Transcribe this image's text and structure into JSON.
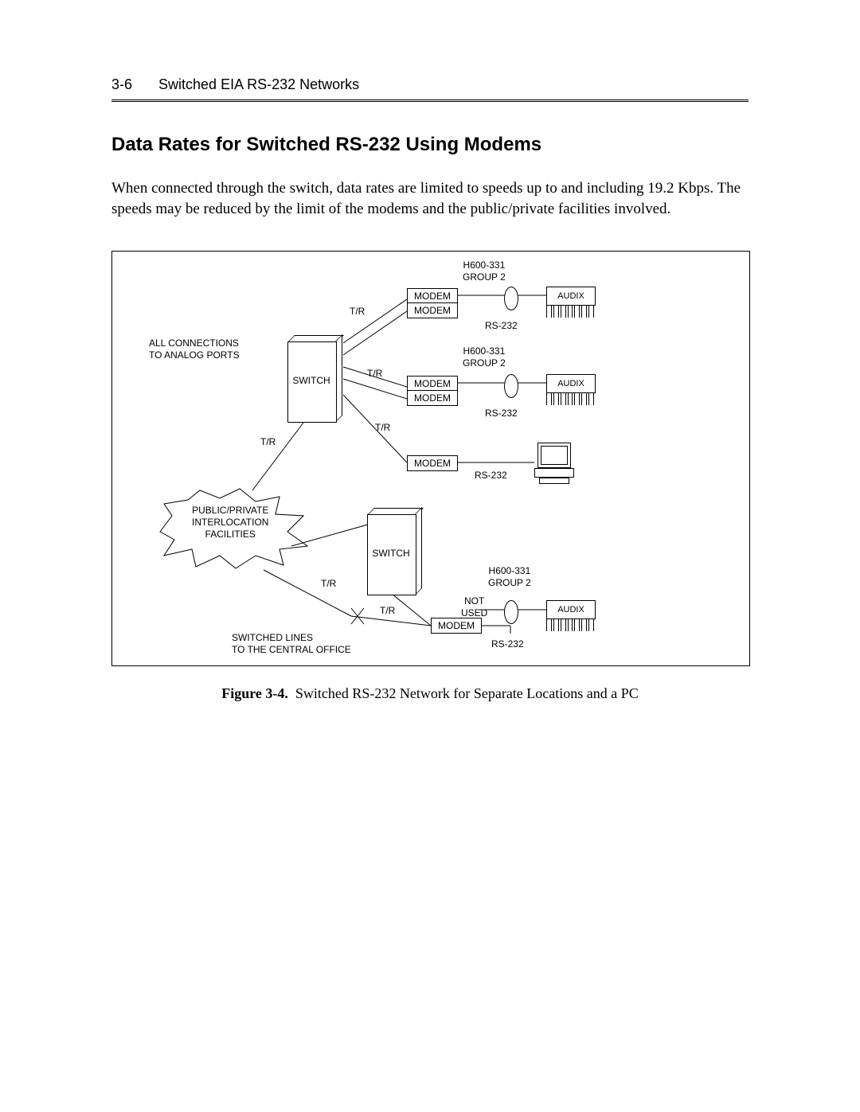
{
  "header": {
    "page_num": "3-6",
    "running_title": "Switched EIA RS-232 Networks"
  },
  "section_title": "Data Rates for Switched RS-232 Using Modems",
  "body_text": "When connected through the switch, data rates are limited to speeds up to and including 19.2 Kbps.  The speeds may be reduced by the limit of the modems and the public/private facilities involved.",
  "figure": {
    "caption_label": "Figure 3-4.",
    "caption_text": "Switched RS-232 Network for Separate Locations and a PC",
    "labels": {
      "all_conn": "ALL CONNECTIONS\nTO ANALOG PORTS",
      "switch": "SWITCH",
      "modem": "MODEM",
      "audix": "AUDIX",
      "tr": "T/R",
      "h600": "H600-331\nGROUP 2",
      "rs232": "RS-232",
      "not_used": "NOT\nUSED",
      "cloud": "PUBLIC/PRIVATE\nINTERLOCATION\nFACILITIES",
      "switched_lines": "SWITCHED LINES\nTO THE CENTRAL OFFICE"
    }
  }
}
